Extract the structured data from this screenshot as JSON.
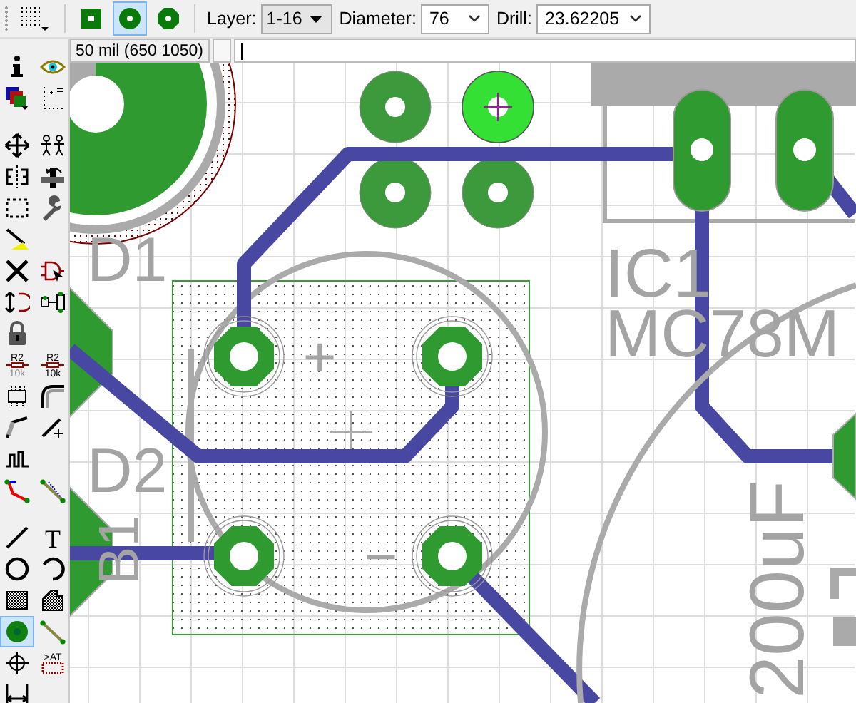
{
  "toolbar": {
    "via_shapes": [
      {
        "kind": "square",
        "selected": false
      },
      {
        "kind": "round",
        "selected": true
      },
      {
        "kind": "octagon",
        "selected": false
      }
    ],
    "layer": {
      "label": "Layer:",
      "value": "1-16"
    },
    "diameter": {
      "label": "Diameter:",
      "value": "76"
    },
    "drill": {
      "label": "Drill:",
      "value": "23.62205"
    }
  },
  "coordinates": "50 mil (650 1050)",
  "tools": [
    [
      {
        "kind": "info",
        "selected": false
      },
      {
        "kind": "show",
        "selected": false
      },
      {
        "kind": "display",
        "selected": false
      },
      {
        "kind": "grid",
        "selected": false
      }
    ],
    [
      {
        "kind": "move",
        "selected": false
      },
      {
        "kind": "copy",
        "selected": false
      },
      {
        "kind": "mirror",
        "selected": false
      },
      {
        "kind": "rotate",
        "selected": false
      },
      {
        "kind": "group",
        "selected": false
      },
      {
        "kind": "change",
        "selected": false
      },
      {
        "kind": "paste",
        "selected": false
      },
      {
        "kind": "blank"
      },
      {
        "kind": "delete",
        "selected": false
      },
      {
        "kind": "add",
        "selected": false
      },
      {
        "kind": "replace",
        "selected": false
      },
      {
        "kind": "swap",
        "selected": false
      },
      {
        "kind": "lock",
        "selected": false
      },
      {
        "kind": "blank"
      },
      {
        "kind": "name",
        "selected": false,
        "glyphs": [
          "R2",
          "10k"
        ]
      },
      {
        "kind": "value",
        "selected": false,
        "glyphs": [
          "R2",
          "10k"
        ]
      },
      {
        "kind": "smash",
        "selected": false
      },
      {
        "kind": "miter",
        "selected": false
      },
      {
        "kind": "split",
        "selected": false
      },
      {
        "kind": "optimize",
        "selected": false
      },
      {
        "kind": "meander",
        "selected": false
      },
      {
        "kind": "blank"
      },
      {
        "kind": "route",
        "selected": false
      },
      {
        "kind": "ripup",
        "selected": false
      }
    ],
    [
      {
        "kind": "wire",
        "selected": false
      },
      {
        "kind": "text",
        "selected": false,
        "glyphs": [
          "T"
        ]
      },
      {
        "kind": "circle",
        "selected": false
      },
      {
        "kind": "arc",
        "selected": false
      },
      {
        "kind": "rect",
        "selected": false
      },
      {
        "kind": "polygon",
        "selected": false
      },
      {
        "kind": "via",
        "selected": true
      },
      {
        "kind": "signal",
        "selected": false
      },
      {
        "kind": "hole",
        "selected": false
      },
      {
        "kind": "attribute",
        "selected": false,
        "glyphs": [
          ">AT"
        ]
      },
      {
        "kind": "dimension",
        "selected": false
      }
    ]
  ],
  "canvas": {
    "labels": [
      {
        "kind": "name_1",
        "text": "D1"
      },
      {
        "kind": "name_2",
        "text": "D2"
      },
      {
        "kind": "name_3",
        "text": "B1"
      },
      {
        "kind": "plus",
        "text": "+"
      },
      {
        "kind": "minus",
        "text": "−"
      },
      {
        "kind": "ic_name",
        "text": "IC1"
      },
      {
        "kind": "ic_value",
        "text": "MC78M"
      },
      {
        "kind": "cap_value",
        "text": "200uF"
      }
    ]
  }
}
